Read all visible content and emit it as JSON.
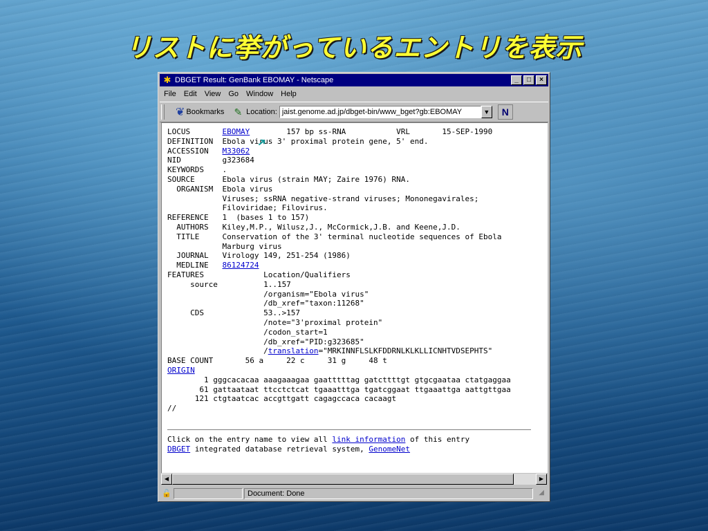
{
  "slide": {
    "title": "リストに挙がっているエントリを表示"
  },
  "window": {
    "title": "DBGET Result: GenBank EBOMAY - Netscape",
    "minimize": "_",
    "maximize": "□",
    "close": "×"
  },
  "menu": [
    "File",
    "Edit",
    "View",
    "Go",
    "Window",
    "Help"
  ],
  "toolbar": {
    "bookmarks_label": "Bookmarks",
    "location_label": "Location:",
    "location_value": "jaist.genome.ad.jp/dbget-bin/www_bget?gb:EBOMAY",
    "logo": "N"
  },
  "record": {
    "locus_key": "LOCUS       ",
    "locus_link": "EBOMAY",
    "locus_rest": "        157 bp ss-RNA           VRL       15-SEP-1990",
    "definition": "DEFINITION  Ebola virus 3' proximal protein gene, 5' end.",
    "accession_key": "ACCESSION   ",
    "accession_link": "M33062",
    "nid": "NID         g323684",
    "keywords": "KEYWORDS    .",
    "source": "SOURCE      Ebola virus (strain MAY; Zaire 1976) RNA.",
    "organism1": "  ORGANISM  Ebola virus",
    "organism2": "            Viruses; ssRNA negative-strand viruses; Mononegavirales;",
    "organism3": "            Filoviridae; Filovirus.",
    "reference": "REFERENCE   1  (bases 1 to 157)",
    "authors": "  AUTHORS   Kiley,M.P., Wilusz,J., McCormick,J.B. and Keene,J.D.",
    "title1": "  TITLE     Conservation of the 3' terminal nucleotide sequences of Ebola",
    "title2": "            Marburg virus",
    "journal": "  JOURNAL   Virology 149, 251-254 (1986)",
    "medline_key": "  MEDLINE   ",
    "medline_link": "86124724",
    "features": "FEATURES             Location/Qualifiers",
    "source_feat": "     source          1..157",
    "organism_q": "                     /organism=\"Ebola virus\"",
    "xref_q": "                     /db_xref=\"taxon:11268\"",
    "cds": "     CDS             53..>157",
    "note_q": "                     /note=\"3'proximal protein\"",
    "codon_q": "                     /codon_start=1",
    "pid_q": "                     /db_xref=\"PID:g323685\"",
    "translation_pre": "                     /",
    "translation_link": "translation",
    "translation_post": "=\"MRKINNFLSLKFDDRNLKLKLLICNHTVDSEPHTS\"",
    "base_count": "BASE COUNT       56 a     22 c     31 g     48 t",
    "origin_link": "ORIGIN",
    "seq1": "        1 gggcacacaa aaagaaagaa gaatttttag gatcttttgt gtgcgaataa ctatgaggaa",
    "seq2": "       61 gattaataat ttcctctcat tgaaatttga tgatcggaat ttgaaattga aattgttgaa",
    "seq3": "      121 ctgtaatcac accgttgatt cagagccaca cacaagt",
    "end": "//"
  },
  "footer": {
    "line1_pre": "Click on the entry name to view all ",
    "line1_link": "link information",
    "line1_post": " of this entry",
    "line2_link1": "DBGET",
    "line2_mid": " integrated database retrieval system, ",
    "line2_link2": "GenomeNet"
  },
  "status": {
    "text": "Document: Done"
  }
}
